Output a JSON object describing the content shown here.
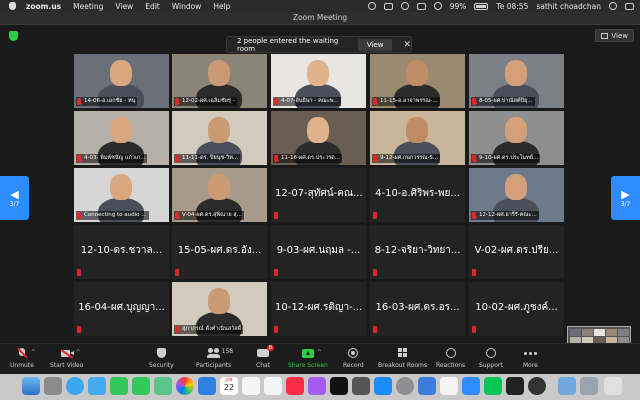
{
  "menubar": {
    "app": "zoom.us",
    "items": [
      "Meeting",
      "View",
      "Edit",
      "Window",
      "Help"
    ],
    "battery": "99%",
    "clock": "Te 08:55",
    "user": "sathit choadchan"
  },
  "window": {
    "title": "Zoom Meeting"
  },
  "view_button": {
    "label": "View"
  },
  "toast": {
    "message": "2 people entered the waiting room",
    "view_label": "View",
    "close": "✕"
  },
  "pager": {
    "left_label": "3/7",
    "right_label": "3/7",
    "left_arrow": "◀",
    "right_arrow": "▶"
  },
  "tiles": [
    {
      "label": "14-06-อ.เอกชัย - หนุ",
      "type": "video"
    },
    {
      "label": "12-02-ผศ.เฉลิมชัยรุ่ -",
      "type": "video"
    },
    {
      "label": "4-07-อันธิษา - คณะพ...",
      "type": "video"
    },
    {
      "label": "11-15-อ.อาจาพรรณ-...",
      "type": "video"
    },
    {
      "label": "8-05-ผศ.ปาณัสต์ปิยุ...",
      "type": "video"
    },
    {
      "label": "4-03- พิมพ์ชนัญ แก้วเก...",
      "type": "video"
    },
    {
      "label": "11-11-ดร. ปิยนุช-วิท...",
      "type": "video"
    },
    {
      "label": "11-18-ผศ.ดร.ประวรด...",
      "type": "video"
    },
    {
      "label": "9-12-ผศ.กนกวรรณ-5...",
      "type": "video"
    },
    {
      "label": "9-10-ผศ.ดร.ประโมทย์...",
      "type": "video"
    },
    {
      "label": "Connecting to audio ...",
      "type": "video"
    },
    {
      "label": "V-04-ผศ.ดร.สุพิณาย สุ...",
      "type": "video"
    },
    {
      "label": "12-07-สุทัศน์-คณ...",
      "type": "name"
    },
    {
      "label": "4-10-อ.ศิริพร-พย...",
      "type": "name"
    },
    {
      "label": "12-12-ผศ.อารีรั-คณะ...",
      "type": "video"
    },
    {
      "label": "12-10-ดร.ชวาล...",
      "type": "name"
    },
    {
      "label": "15-05-ผศ.ดร.อัง...",
      "type": "name"
    },
    {
      "label": "9-03-ผศ.นฤมล -...",
      "type": "name"
    },
    {
      "label": "8-12-จริยา-วิทยา...",
      "type": "name"
    },
    {
      "label": "V-02-ผศ.ดร.ปรีย...",
      "type": "name"
    },
    {
      "label": "16-04-ผศ.บุญญา...",
      "type": "name"
    },
    {
      "label": "สุภาภรณ์ ตั้งตำเนินสวัสดิ์",
      "type": "video"
    },
    {
      "label": "10-12-ผศ.รติญา-...",
      "type": "name"
    },
    {
      "label": "16-03-ผศ.ดร.อร...",
      "type": "name"
    },
    {
      "label": "10-02-ผศ.ภูชงค์...",
      "type": "name"
    }
  ],
  "toolbar": {
    "unmute": "Unmute",
    "start_video": "Start Video",
    "security": "Security",
    "participants": "Participants",
    "participants_count": "158",
    "chat": "Chat",
    "chat_badge": "8",
    "share_screen": "Share Screen",
    "record": "Record",
    "breakout_rooms": "Breakout Rooms",
    "reactions": "Reactions",
    "support": "Support",
    "more": "More"
  },
  "dock": {
    "calendar_day": "22",
    "calendar_month": "JUN"
  },
  "colors": {
    "accent": "#2d8cff",
    "share": "#2ecc40",
    "mute": "#e02828",
    "background": "#1a1a1a"
  }
}
